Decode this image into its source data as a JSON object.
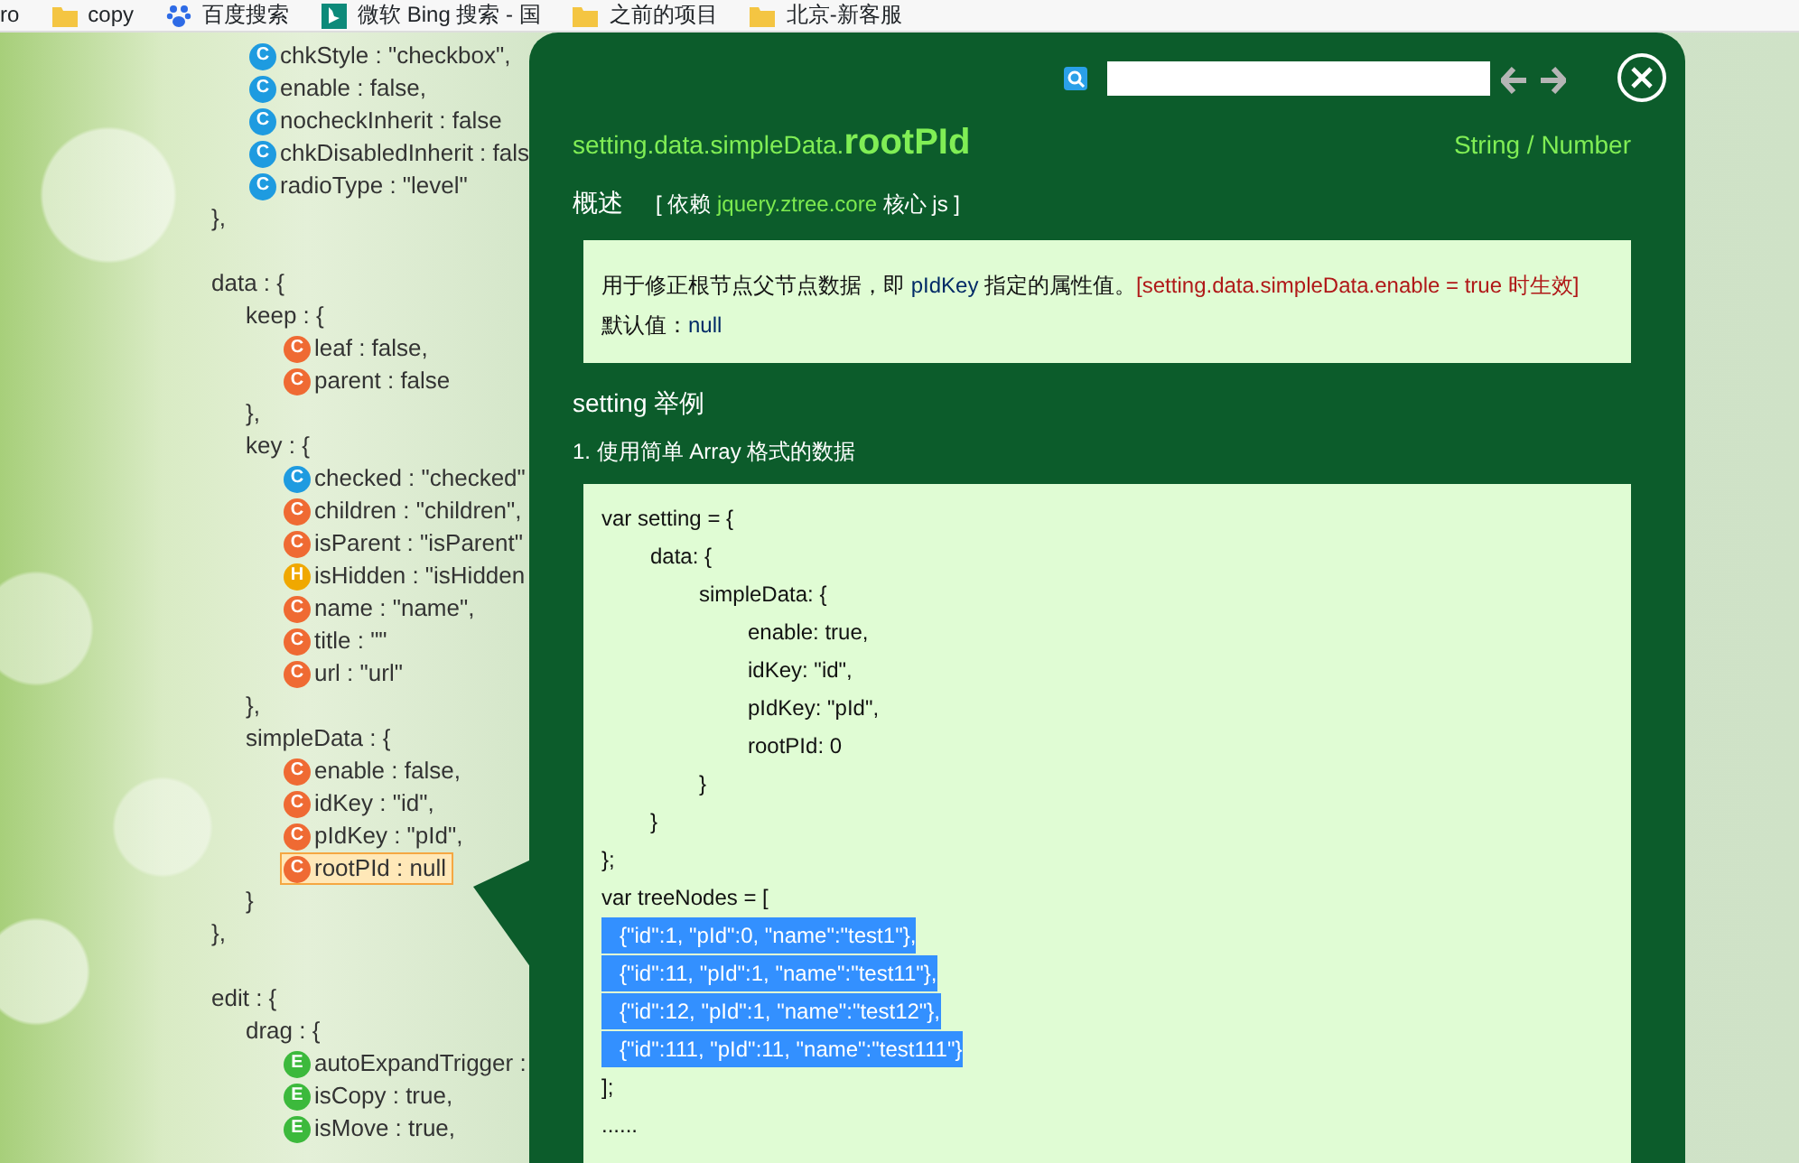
{
  "bookmarks": [
    {
      "kind": "none",
      "label": "ro"
    },
    {
      "kind": "folder",
      "label": "copy"
    },
    {
      "kind": "paw",
      "label": "百度搜索"
    },
    {
      "kind": "bing",
      "label": "微软 Bing 搜索 - 国"
    },
    {
      "kind": "folder",
      "label": "之前的项目"
    },
    {
      "kind": "folder",
      "label": "北京-新客服"
    }
  ],
  "tree": [
    {
      "children": [
        {
          "icon": "C",
          "color": "#1e9be0",
          "text": "chkStyle : \"checkbox\",",
          "selected": false
        },
        {
          "icon": "C",
          "color": "#1e9be0",
          "text": "enable : false,",
          "selected": false
        },
        {
          "icon": "C",
          "color": "#1e9be0",
          "text": "nocheckInherit : false",
          "selected": false
        },
        {
          "icon": "C",
          "color": "#1e9be0",
          "text": "chkDisabledInherit : fals",
          "selected": false
        },
        {
          "icon": "C",
          "color": "#1e9be0",
          "text": "radioType : \"level\"",
          "selected": false
        }
      ],
      "close": "},"
    },
    {
      "label": "data : {",
      "children": [
        {
          "label": "keep : {",
          "children": [
            {
              "icon": "C",
              "color": "#ef6a33",
              "text": "leaf : false,",
              "selected": false
            },
            {
              "icon": "C",
              "color": "#ef6a33",
              "text": "parent : false",
              "selected": false
            }
          ],
          "close": "},"
        },
        {
          "label": "key : {",
          "children": [
            {
              "icon": "C",
              "color": "#1e9be0",
              "text": "checked : \"checked\"",
              "selected": false
            },
            {
              "icon": "C",
              "color": "#ef6a33",
              "text": "children : \"children\",",
              "selected": false
            },
            {
              "icon": "C",
              "color": "#ef6a33",
              "text": "isParent : \"isParent\"",
              "selected": false
            },
            {
              "icon": "H",
              "color": "#f0a800",
              "text": "isHidden : \"isHidden",
              "selected": false
            },
            {
              "icon": "C",
              "color": "#ef6a33",
              "text": "name : \"name\",",
              "selected": false
            },
            {
              "icon": "C",
              "color": "#ef6a33",
              "text": "title : \"\"",
              "selected": false
            },
            {
              "icon": "C",
              "color": "#ef6a33",
              "text": "url : \"url\"",
              "selected": false
            }
          ],
          "close": "},"
        },
        {
          "label": "simpleData : {",
          "children": [
            {
              "icon": "C",
              "color": "#ef6a33",
              "text": "enable : false,",
              "selected": false
            },
            {
              "icon": "C",
              "color": "#ef6a33",
              "text": "idKey : \"id\",",
              "selected": false
            },
            {
              "icon": "C",
              "color": "#ef6a33",
              "text": "pIdKey : \"pId\",",
              "selected": false
            },
            {
              "icon": "C",
              "color": "#ef6a33",
              "text": "rootPId : null",
              "selected": true
            }
          ],
          "close": "}"
        }
      ],
      "close": "},"
    },
    {
      "label": "edit : {",
      "children": [
        {
          "label": "drag : {",
          "children": [
            {
              "icon": "E",
              "color": "#3cb93c",
              "text": "autoExpandTrigger :",
              "selected": false
            },
            {
              "icon": "E",
              "color": "#3cb93c",
              "text": "isCopy : true,",
              "selected": false
            },
            {
              "icon": "E",
              "color": "#3cb93c",
              "text": "isMove : true,",
              "selected": false
            }
          ]
        }
      ]
    }
  ],
  "popup": {
    "title_prefix": "setting.data.simpleData.",
    "title_name": "rootPId",
    "type": "String / Number",
    "overview_label": "概述",
    "dependency": [
      {
        "kind": "plain",
        "text": "[ 依赖 "
      },
      {
        "kind": "link",
        "text": "jquery.ztree.core"
      },
      {
        "kind": "plain",
        "text": " 核心 js ]"
      }
    ],
    "description": [
      {
        "kind": "plain",
        "text": "用于修正根节点父节点数据，即 "
      },
      {
        "kind": "code",
        "text": "pIdKey"
      },
      {
        "kind": "plain",
        "text": " 指定的属性值。"
      },
      {
        "kind": "note",
        "text": "[setting.data.simpleData.enable = true 时生效]"
      }
    ],
    "default": [
      {
        "kind": "plain",
        "text": "默认值："
      },
      {
        "kind": "code",
        "text": "null"
      }
    ],
    "examples_heading": "setting 举例",
    "example_title": "1. 使用简单 Array 格式的数据",
    "code_lines": [
      {
        "text": "var setting = {",
        "selected": false
      },
      {
        "text": "\tdata: {",
        "selected": false
      },
      {
        "text": "\t\tsimpleData: {",
        "selected": false
      },
      {
        "text": "\t\t\tenable: true,",
        "selected": false
      },
      {
        "text": "\t\t\tidKey: \"id\",",
        "selected": false
      },
      {
        "text": "\t\t\tpIdKey: \"pId\",",
        "selected": false
      },
      {
        "text": "\t\t\trootPId: 0",
        "selected": false
      },
      {
        "text": "\t\t}",
        "selected": false
      },
      {
        "text": "\t}",
        "selected": false
      },
      {
        "text": "};",
        "selected": false
      },
      {
        "text": "var treeNodes = [",
        "selected": false
      },
      {
        "text": "   {\"id\":1, \"pId\":0, \"name\":\"test1\"},",
        "selected": true
      },
      {
        "text": "   {\"id\":11, \"pId\":1, \"name\":\"test11\"},",
        "selected": true
      },
      {
        "text": "   {\"id\":12, \"pId\":1, \"name\":\"test12\"},",
        "selected": true
      },
      {
        "text": "   {\"id\":111, \"pId\":11, \"name\":\"test111\"}",
        "selected": true
      },
      {
        "text": "];",
        "selected": false
      },
      {
        "text": "......",
        "selected": false
      }
    ]
  }
}
